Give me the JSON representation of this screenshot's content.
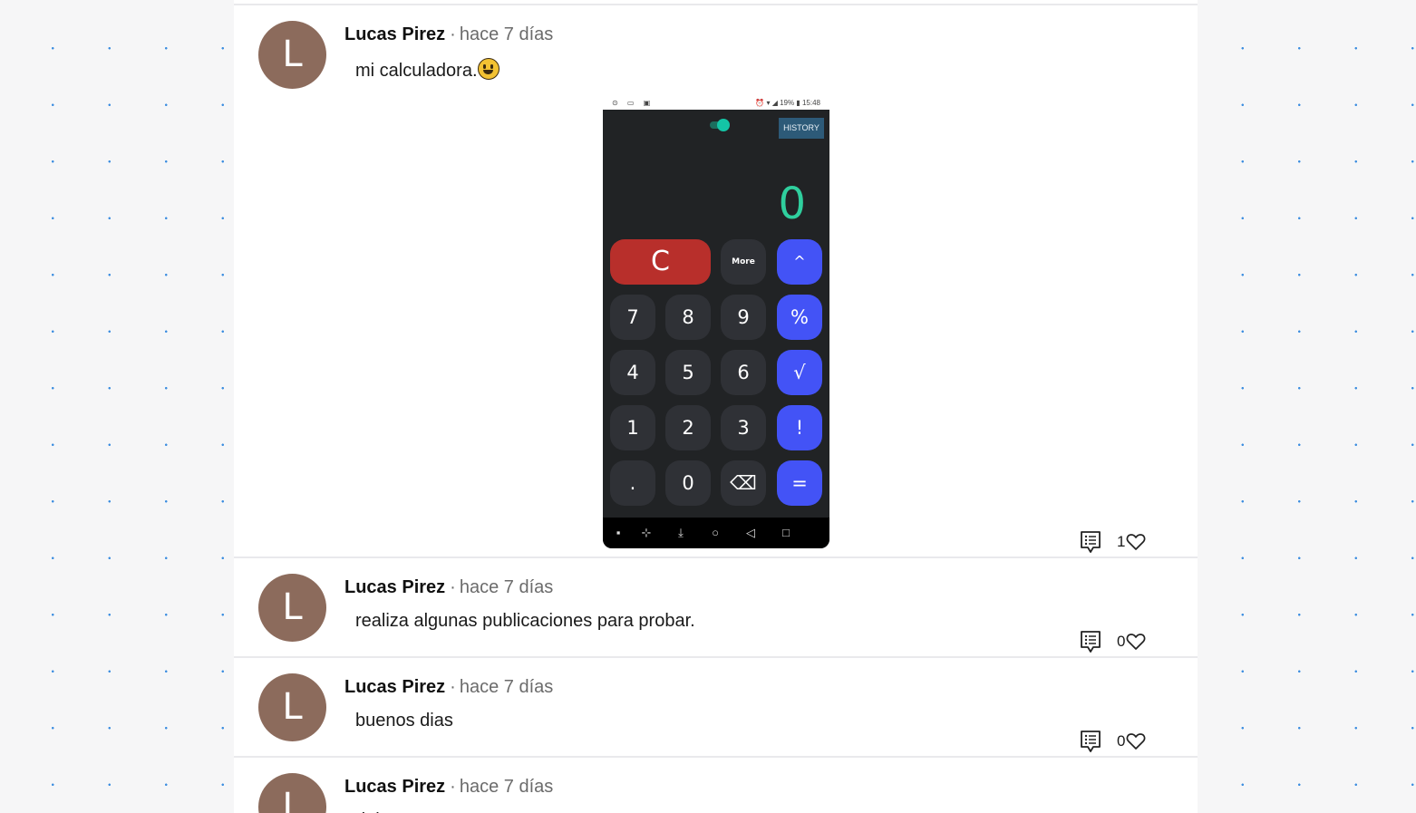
{
  "posts": [
    {
      "author": "Lucas Pirez",
      "separator": "·",
      "time": "hace 7 días",
      "avatar_letter": "L",
      "text": "mi calculadora.",
      "has_emoji": true,
      "likes": "1",
      "screenshot": {
        "status_left_icons": "⊙ ▭ ▣",
        "status_right": "⏰ ▾ ◢ 19% ▮ 15:48",
        "history_label": "HISTORY",
        "display_value": "0",
        "keys": {
          "clear": "C",
          "more": "More",
          "power": "^",
          "k7": "7",
          "k8": "8",
          "k9": "9",
          "percent": "%",
          "k4": "4",
          "k5": "5",
          "k6": "6",
          "sqrt": "√",
          "k1": "1",
          "k2": "2",
          "k3": "3",
          "factorial": "!",
          "dot": ".",
          "k0": "0",
          "backspace": "⌫",
          "equals": "="
        },
        "nav_icons": [
          "▪",
          "⊹",
          "⤓",
          "○",
          "◁",
          "□"
        ]
      }
    },
    {
      "author": "Lucas Pirez",
      "separator": "·",
      "time": "hace 7 días",
      "avatar_letter": "L",
      "text": "realiza algunas publicaciones para probar.",
      "likes": "0"
    },
    {
      "author": "Lucas Pirez",
      "separator": "·",
      "time": "hace 7 días",
      "avatar_letter": "L",
      "text": "buenos dias",
      "likes": "0"
    },
    {
      "author": "Lucas Pirez",
      "separator": "·",
      "time": "hace 7 días",
      "avatar_letter": "L",
      "text": "dale",
      "likes": ""
    }
  ],
  "colors": {
    "avatar": "#8c6b5c",
    "accent_blue": "#4353f6",
    "clear_red": "#b82f2b",
    "display_green": "#2fcf9e"
  }
}
